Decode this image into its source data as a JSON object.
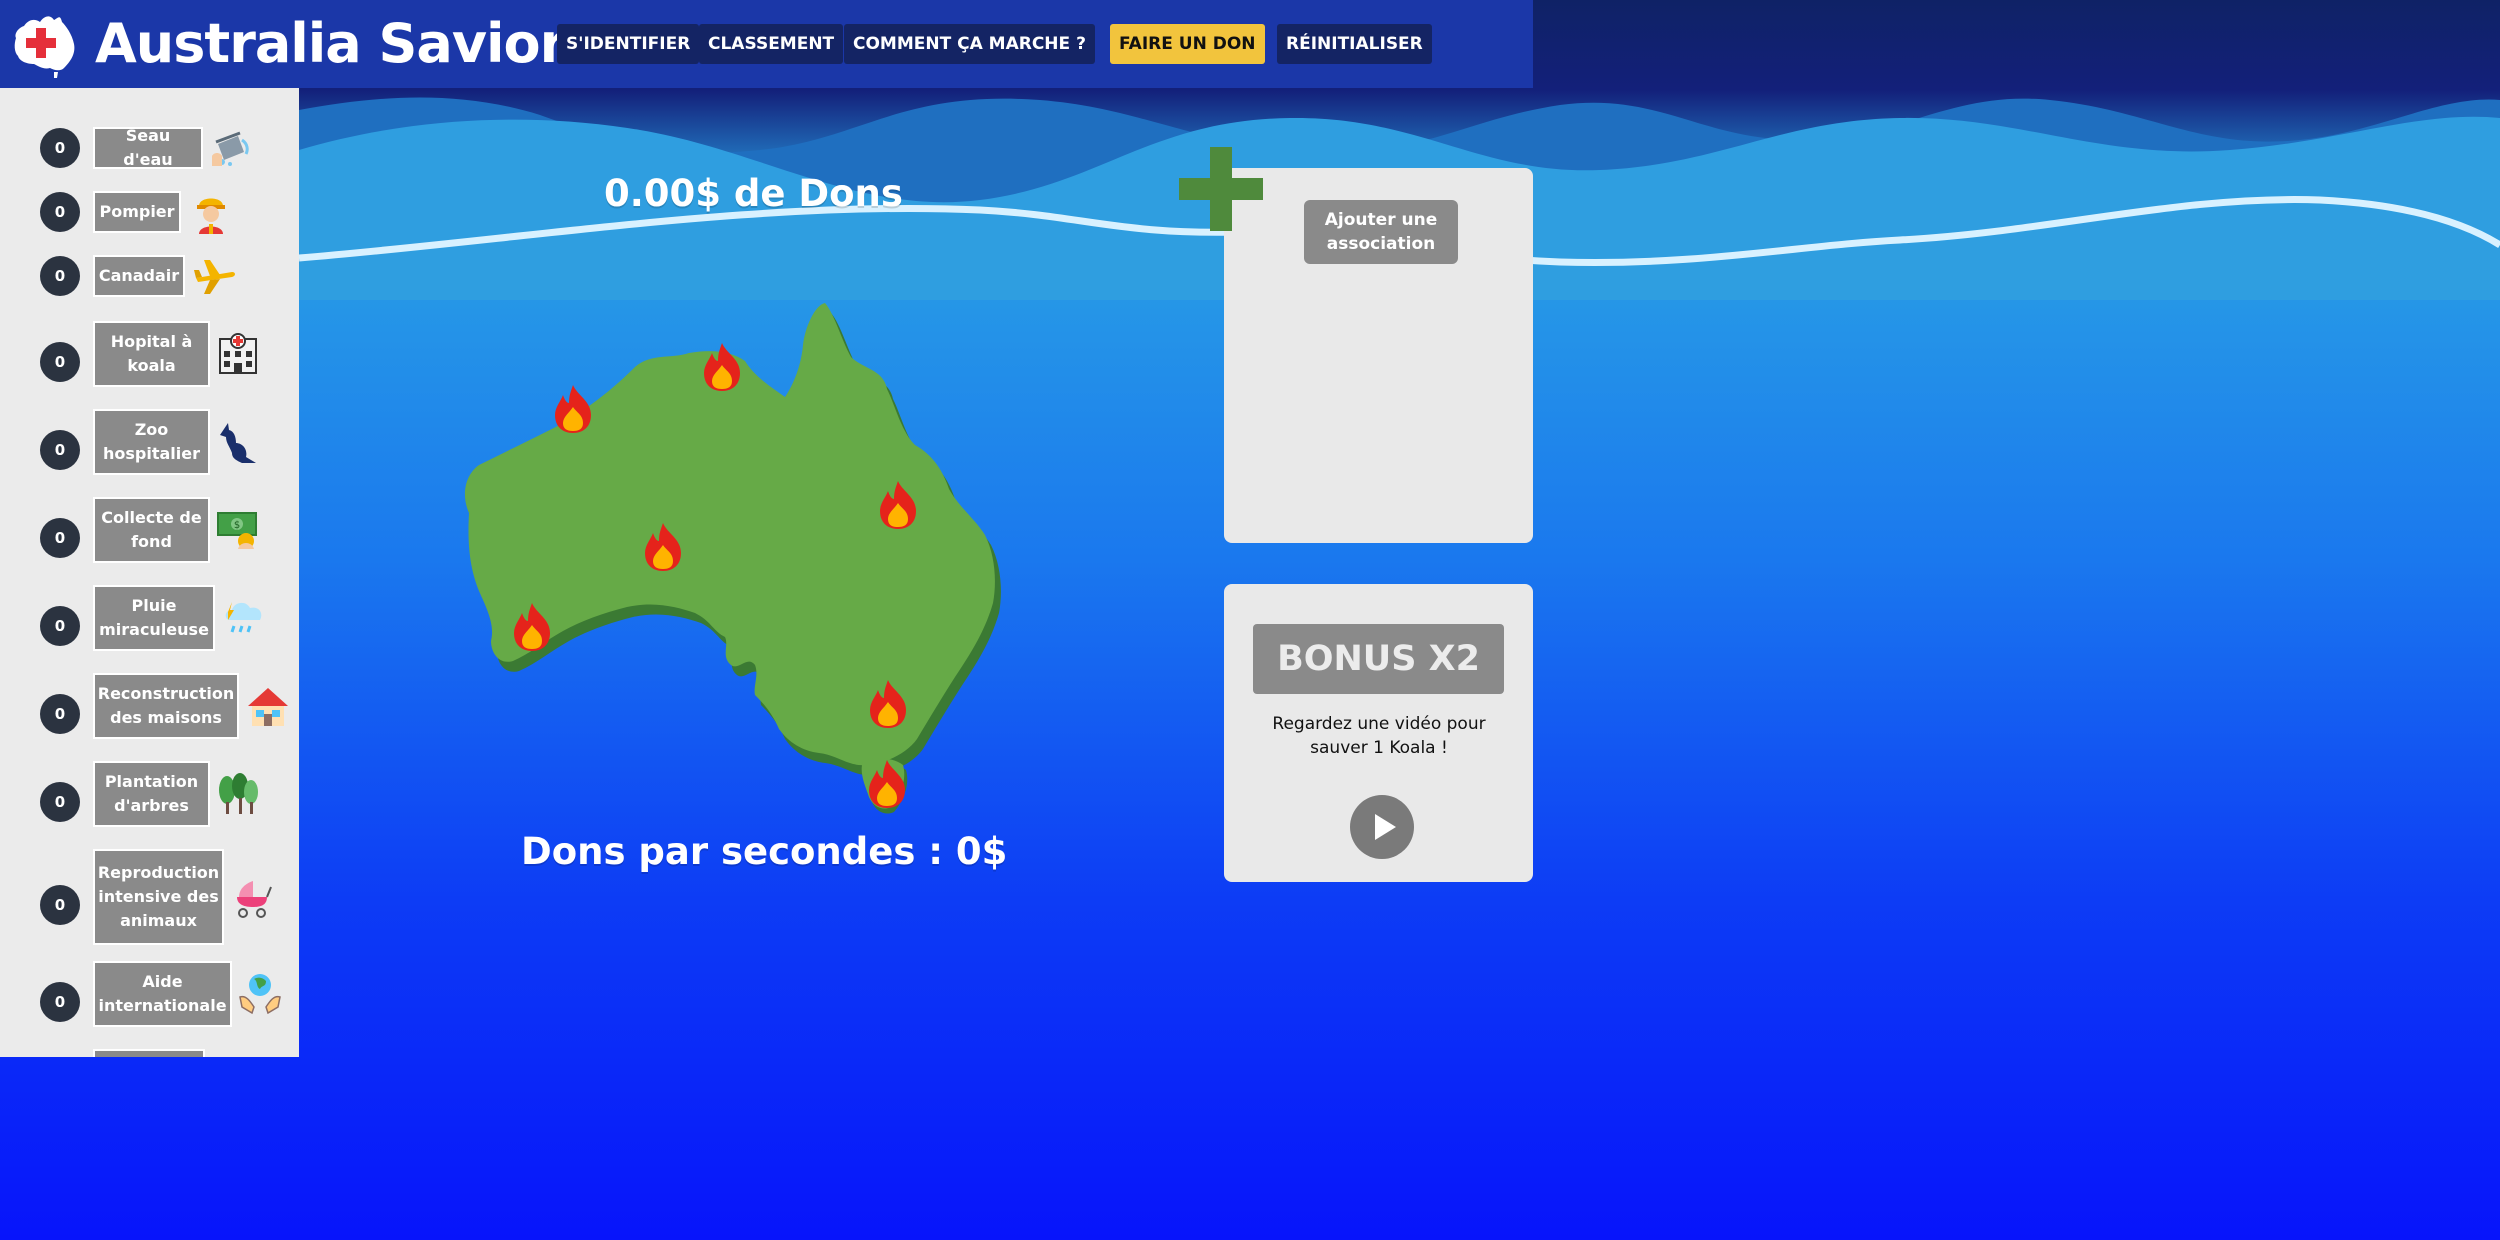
{
  "app": {
    "title": "Australia Savior"
  },
  "nav": [
    {
      "label": "S'IDENTIFIER"
    },
    {
      "label": "CLASSEMENT"
    },
    {
      "label": "COMMENT ÇA MARCHE ?"
    },
    {
      "label": "FAIRE UN DON"
    },
    {
      "label": "RÉINITIALISER"
    }
  ],
  "sidebar": {
    "items": [
      {
        "count": "0",
        "label": "Seau d'eau",
        "icon": "water-bucket-icon"
      },
      {
        "count": "0",
        "label": "Pompier",
        "icon": "firefighter-icon"
      },
      {
        "count": "0",
        "label": "Canadair",
        "icon": "airplane-icon"
      },
      {
        "count": "0",
        "label": "Hopital à koala",
        "icon": "hospital-icon"
      },
      {
        "count": "0",
        "label": "Zoo hospitalier",
        "icon": "kangaroo-icon"
      },
      {
        "count": "0",
        "label": "Collecte de fond",
        "icon": "money-icon"
      },
      {
        "count": "0",
        "label": "Pluie miraculeuse",
        "icon": "rain-cloud-icon"
      },
      {
        "count": "0",
        "label": "Reconstruction des maisons",
        "icon": "house-icon"
      },
      {
        "count": "0",
        "label": "Plantation d'arbres",
        "icon": "trees-icon"
      },
      {
        "count": "0",
        "label": "Reproduction intensive des animaux",
        "icon": "stroller-icon"
      },
      {
        "count": "0",
        "label": "Aide internationale",
        "icon": "globe-hands-icon"
      }
    ]
  },
  "main": {
    "donations": "0.00$ de Dons",
    "per_second": "Dons par secondes : 0$",
    "fires": 7
  },
  "association": {
    "add_label": "Ajouter une association"
  },
  "bonus": {
    "title": "BONUS X2",
    "text": "Regardez une vidéo pour sauver 1 Koala !"
  },
  "colors": {
    "header": "#1b37a8",
    "nav_button": "#142464",
    "donate_button": "#f2c43d",
    "map_green": "#66aa47",
    "plus_green": "#4f8a3c",
    "panel": "#e9e9e9",
    "gray_button": "#8a8a8a"
  }
}
